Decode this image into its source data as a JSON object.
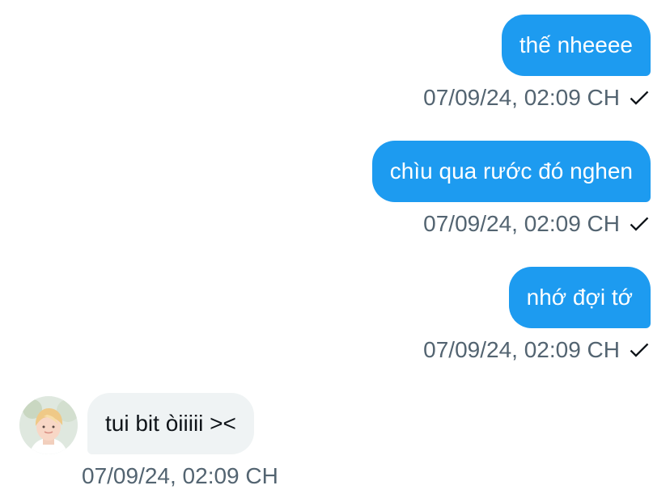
{
  "conversation": {
    "outgoing": [
      {
        "text": "thế nheeee",
        "timestamp": "07/09/24, 02:09 CH",
        "status_icon": "checkmark-icon"
      },
      {
        "text": "chìu qua rước đó nghen",
        "timestamp": "07/09/24, 02:09 CH",
        "status_icon": "checkmark-icon"
      },
      {
        "text": "nhớ đợi tớ",
        "timestamp": "07/09/24, 02:09 CH",
        "status_icon": "checkmark-icon"
      }
    ],
    "incoming": [
      {
        "text": "tui bit òiiiii ><",
        "timestamp": "07/09/24, 02:09 CH",
        "avatar_icon": "avatar-icon"
      }
    ]
  },
  "colors": {
    "outgoing_bubble": "#1d9bf0",
    "incoming_bubble": "#eff3f4",
    "timestamp": "#536471",
    "text_dark": "#0f1419"
  }
}
